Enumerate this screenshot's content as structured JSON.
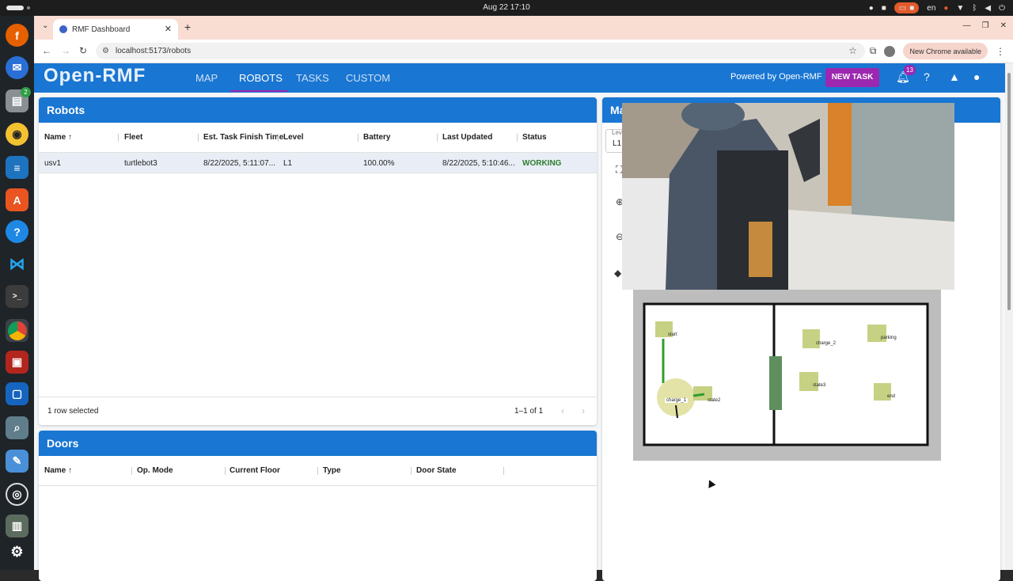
{
  "system": {
    "clock": "Aug 22  17:10",
    "lang": "en"
  },
  "dock": {
    "files_badge": "2"
  },
  "browser": {
    "tab_title": "RMF Dashboard",
    "url": "localhost:5173/robots",
    "update_label": "New Chrome available"
  },
  "app": {
    "logo": "Open-RMF",
    "nav": [
      "MAP",
      "ROBOTS",
      "TASKS",
      "CUSTOM"
    ],
    "powered_by": "Powered by Open-RMF",
    "new_task": "NEW TASK",
    "notification_count": "13"
  },
  "robots": {
    "title": "Robots",
    "columns": [
      "Name",
      "Fleet",
      "Est. Task Finish Time",
      "Level",
      "Battery",
      "Last Updated",
      "Status"
    ],
    "rows": [
      [
        "usv1",
        "turtlebot3",
        "8/22/2025, 5:11:07...",
        "L1",
        "100.00%",
        "8/22/2025, 5:10:46...",
        "WORKING"
      ]
    ],
    "selected_text": "1 row selected",
    "pagination": "1–1 of 1"
  },
  "doors": {
    "title": "Doors",
    "columns": [
      "Name",
      "Op. Mode",
      "Current Floor",
      "Type",
      "Door State"
    ]
  },
  "map_panel": {
    "title_fragment": "Ma",
    "level_label": "Lev",
    "level_value": "L1",
    "waypoints": [
      "start",
      "charge_2",
      "parking",
      "charge_1",
      "state2",
      "state3",
      "end"
    ]
  },
  "colors": {
    "primary": "#1976d2",
    "accent": "#9c27b0",
    "status_working": "#2e7d32"
  }
}
